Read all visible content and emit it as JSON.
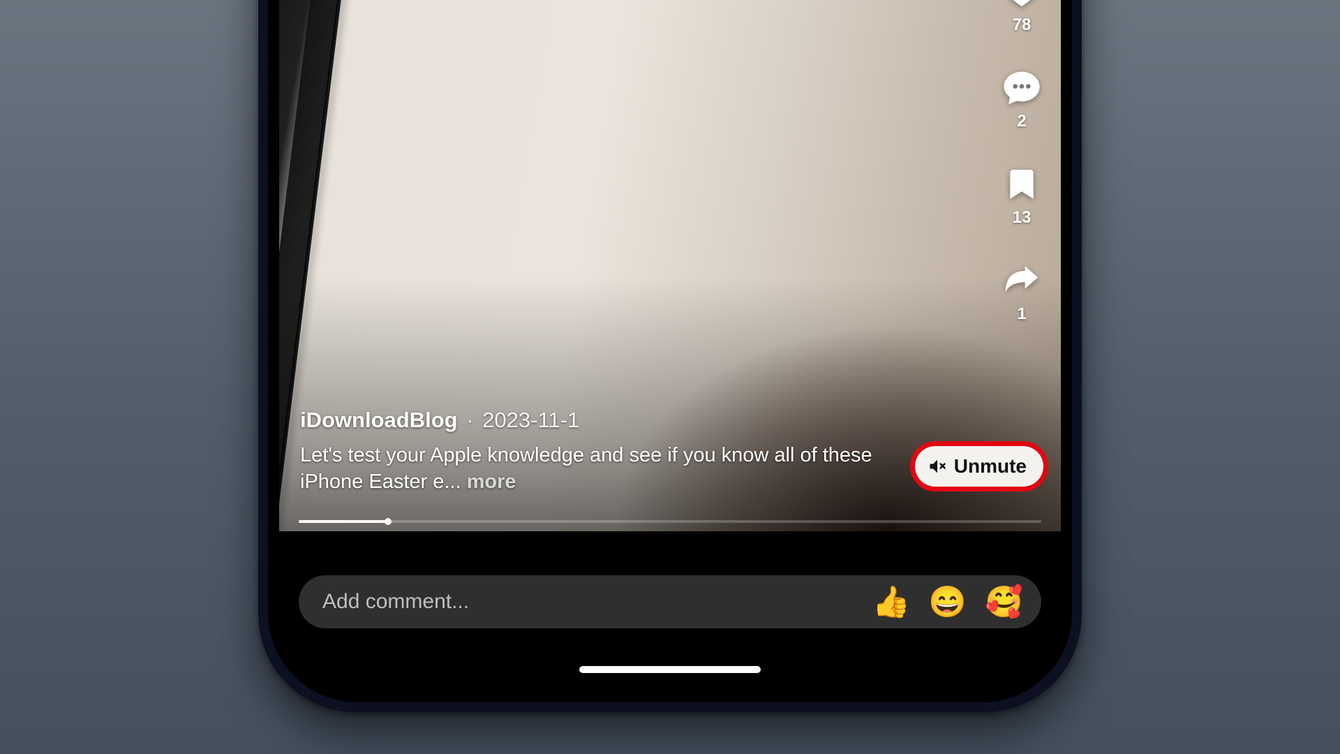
{
  "actions": {
    "like_count": "78",
    "comment_count": "2",
    "bookmark_count": "13",
    "share_count": "1"
  },
  "post": {
    "author": "iDownloadBlog",
    "separator": "·",
    "date": "2023-11-1",
    "caption": "Let's test your Apple knowledge and see if you know all of these iPhone Easter e... ",
    "more_label": "more"
  },
  "unmute": {
    "label": "Unmute"
  },
  "comment": {
    "placeholder": "Add comment...",
    "emoji1": "👍",
    "emoji2": "😄",
    "emoji3": "🥰"
  }
}
